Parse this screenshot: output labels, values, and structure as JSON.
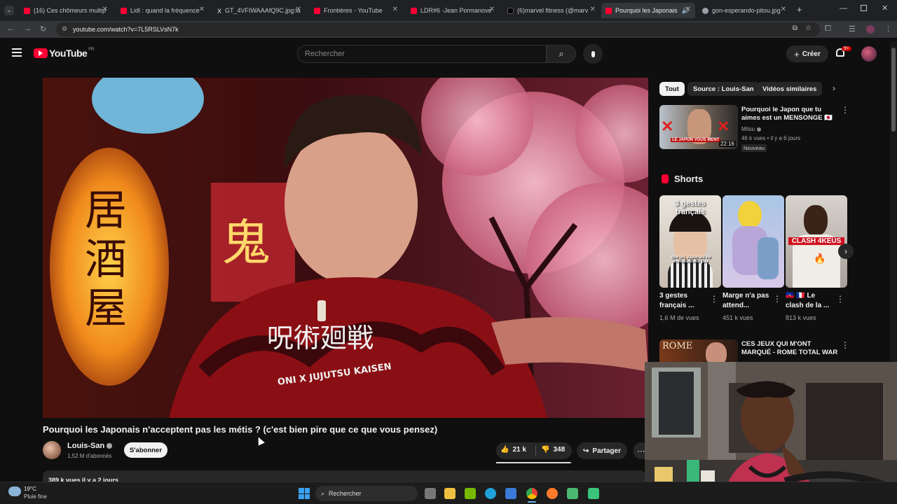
{
  "browser": {
    "tabs": [
      {
        "title": "(16) Ces chômeurs multip",
        "color": "#ff0033"
      },
      {
        "title": "Lidl : quand la fréquence",
        "color": "#ff0033"
      },
      {
        "title": "GT_4VFIWAAAfQ9C.jpg:la",
        "color": "#e8eaed"
      },
      {
        "title": "Frontières - YouTube",
        "color": "#ff0033"
      },
      {
        "title": "LDR#6 -Jean Pormanove",
        "color": "#ff0033"
      },
      {
        "title": "(6)marvel fitness (@marv",
        "color": "#e8eaed"
      },
      {
        "title": "Pourquoi les Japonais",
        "color": "#ff0033"
      },
      {
        "title": "gon-esperando-pitou.jpg",
        "color": "#9aa0a6"
      }
    ],
    "url": "youtube.com/watch?v=7L5RSLVsN7k"
  },
  "header": {
    "logo": "YouTube",
    "region": "FR",
    "search_placeholder": "Rechercher",
    "create_label": "Créer",
    "notif_count": "9+"
  },
  "video": {
    "title": "Pourquoi les Japonais n'acceptent pas les métis ? (c'est bien pire que ce que vous pensez)",
    "shirt_text": "ONI X JUJUTSU KAISEN",
    "channel": "Louis-San",
    "subscribers": "1,52 M d'abonnés",
    "subscribe_label": "S'abonner",
    "likes": "21 k",
    "dislikes": "348",
    "share_label": "Partager",
    "description_peek": "389 k vues  il y a 2 jours"
  },
  "sidebar": {
    "chips": [
      "Tout",
      "Source : Louis-San",
      "Vidéos similaires"
    ],
    "related_top": {
      "title": "Pourquoi le Japon que tu aimes est un MENSONGE 🇯🇵",
      "channel": "Mitsu",
      "meta": "46 k vues • il y a 6 jours",
      "badge": "Nouveau",
      "duration": "22:16",
      "thumb_text": "LE JAPON VOUS MENT"
    },
    "shorts_label": "Shorts",
    "shorts": [
      {
        "title": "3 gestes français ...",
        "views": "1,6 M de vues",
        "overlay": "3 gestes français",
        "caption": "que les Japonais ne comprennent pas"
      },
      {
        "title": "Marge n'a pas attend...",
        "views": "451 k vues",
        "overlay": "",
        "caption": ""
      },
      {
        "title": "🇭🇹 🇫🇷 Le clash de la ...",
        "views": "813 k vues",
        "overlay": "CLASH 4KEUS",
        "caption": ""
      }
    ],
    "related_bottom": {
      "title": "CES JEUX QUI M'ONT MARQUÉ - ROME TOTAL WAR",
      "thumb_text": "ROME"
    }
  },
  "taskbar": {
    "weather_temp": "19°C",
    "weather_desc": "Pluie fine",
    "search_label": "Rechercher"
  }
}
